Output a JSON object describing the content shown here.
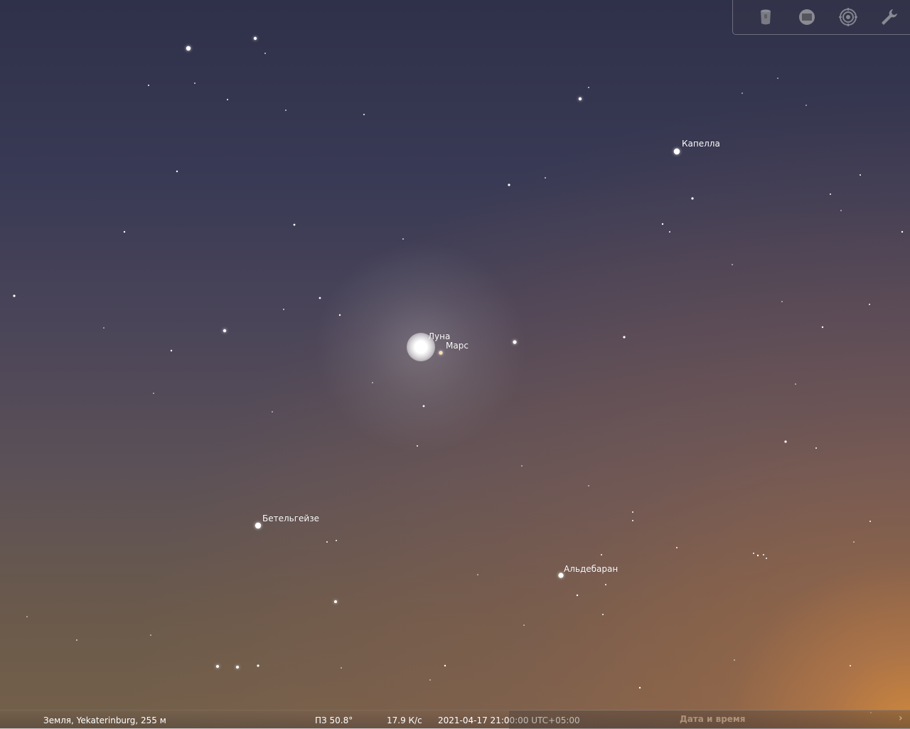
{
  "labels": {
    "capella": "Капелла",
    "moon": "Луна",
    "mars": "Марс",
    "betelgeuse": "Бетельгейзе",
    "aldebaran": "Альдебаран"
  },
  "toolbar": {
    "icons": [
      "sky-culture-icon",
      "view-window-icon",
      "location-target-icon",
      "settings-wrench-icon"
    ]
  },
  "status": {
    "location": "Земля, Yekaterinburg, 255 м",
    "fov": "ПЗ 50.8°",
    "fps": "17.9 К/с",
    "datetime": "2021-04-17 21:00:00 UTC+05:00"
  },
  "panel": {
    "title": "Дата и время",
    "arrow": "›"
  },
  "colors": {
    "sky_top": "#2f3049",
    "sky_bottom": "#74604a",
    "horizon_glow": "#d68c3c",
    "label": "#ffffff",
    "mars": "#ffd9a0"
  }
}
